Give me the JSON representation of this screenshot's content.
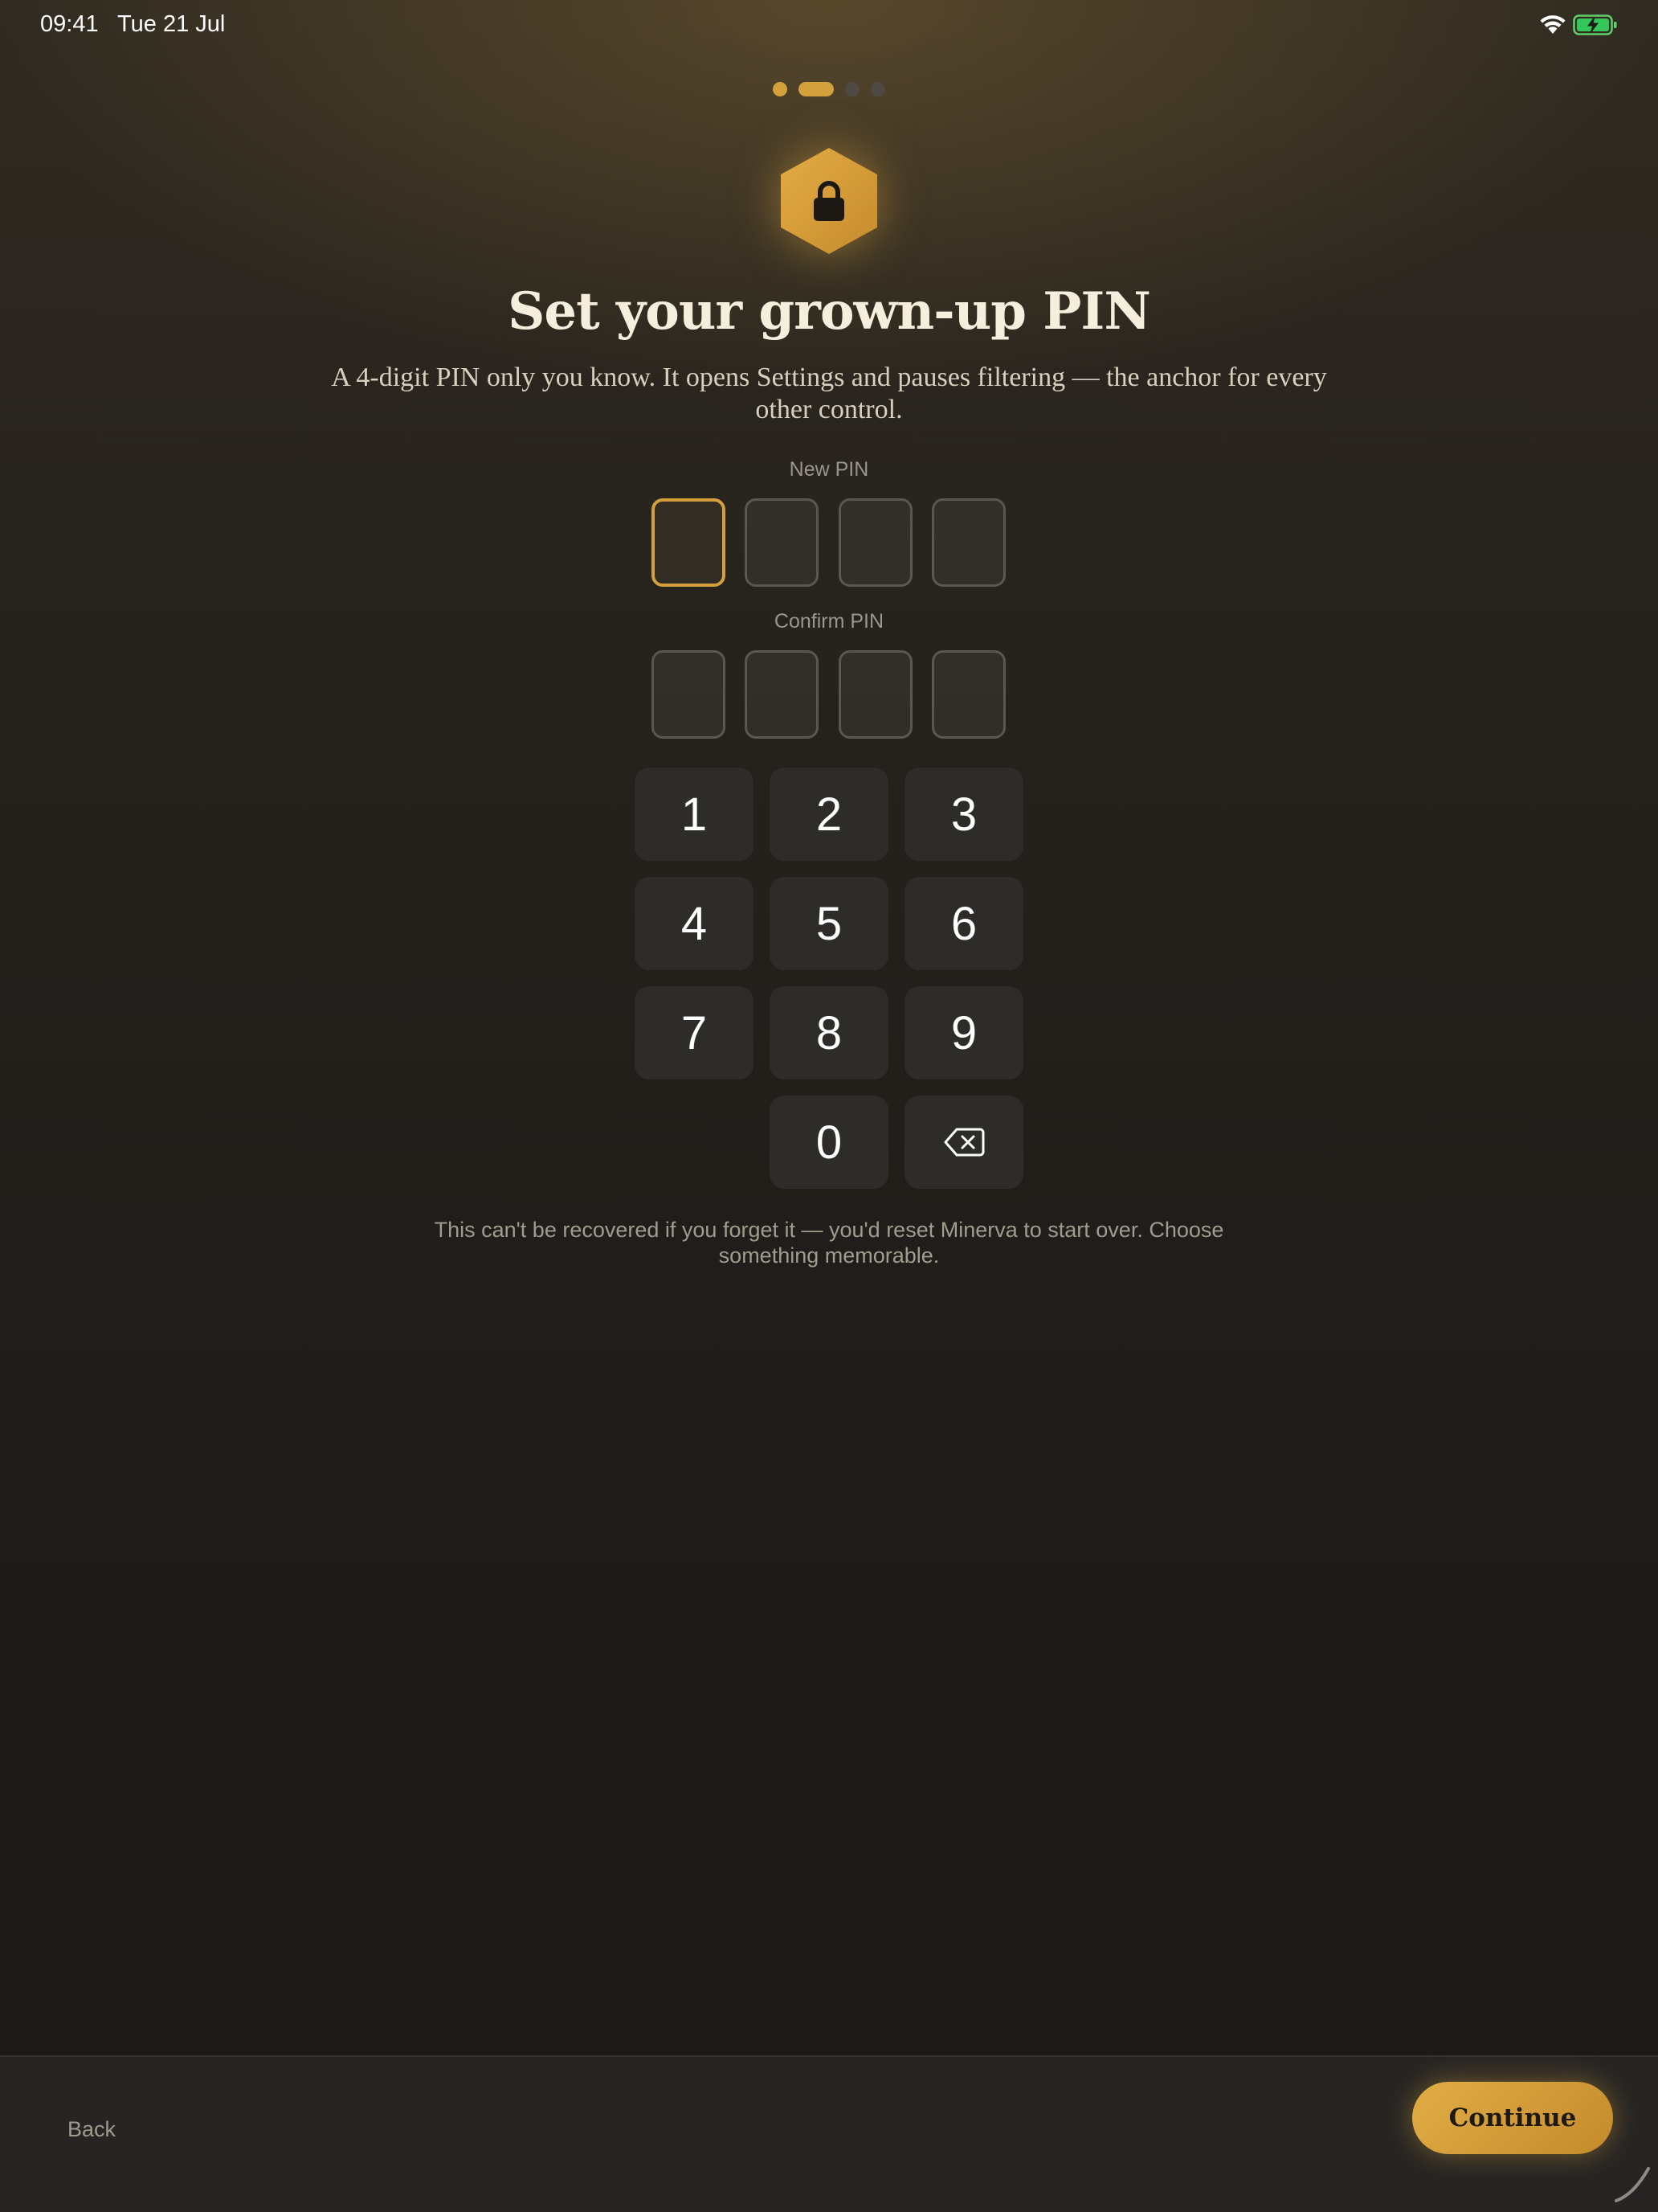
{
  "status_bar": {
    "time": "09:41",
    "date": "Tue 21 Jul",
    "icons": [
      "wifi-icon",
      "battery-charging-icon"
    ]
  },
  "steps": {
    "total": 4,
    "current": 2
  },
  "header": {
    "icon": "lock-icon",
    "title": "Set your grown-up PIN",
    "subtitle": "A 4-digit PIN only you know. It opens Settings and pauses filtering — the anchor for every other control."
  },
  "pin": {
    "new_label": "New PIN",
    "confirm_label": "Confirm PIN",
    "digits": 4
  },
  "keypad": {
    "keys": [
      "1",
      "2",
      "3",
      "4",
      "5",
      "6",
      "7",
      "8",
      "9",
      "0"
    ],
    "delete_icon": "backspace-icon"
  },
  "note": "This can't be recovered if you forget it — you'd reset Minerva to start over. Choose something memorable.",
  "footer": {
    "back_label": "Back",
    "continue_label": "Continue"
  },
  "colors": {
    "accent": "#d4a03c",
    "background": "#1d1b18",
    "key_background": "#2e2c29"
  }
}
